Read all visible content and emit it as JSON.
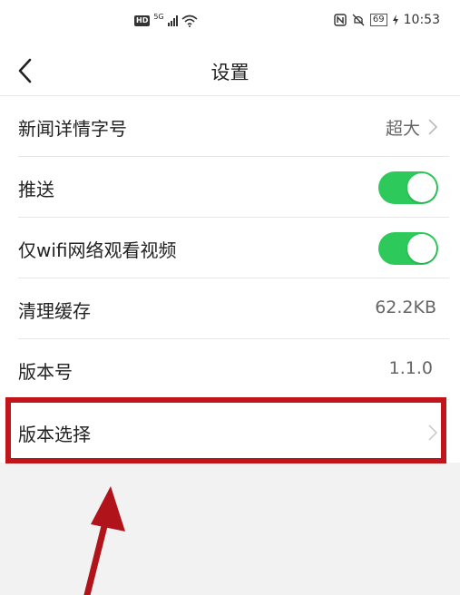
{
  "status_bar": {
    "hd": "HD",
    "network": "5G",
    "battery": "69",
    "time": "10:53"
  },
  "header": {
    "title": "设置"
  },
  "settings": [
    {
      "label": "新闻详情字号",
      "value": "超大"
    },
    {
      "label": "推送",
      "toggle": true
    },
    {
      "label": "仅wifi网络观看视频",
      "toggle": true
    },
    {
      "label": "清理缓存",
      "value": "62.2KB"
    },
    {
      "label": "版本号",
      "value": "1.1.0"
    },
    {
      "label": "版本选择"
    }
  ],
  "colors": {
    "toggle_on": "#2dc95a",
    "highlight": "#c0161b",
    "grey_background": "#f2f2f2"
  },
  "icons": [
    "back-arrow-icon",
    "chevron-right-icon",
    "signal-icon",
    "wifi-icon",
    "nfc-icon",
    "mute-icon",
    "battery-icon",
    "charging-icon"
  ]
}
